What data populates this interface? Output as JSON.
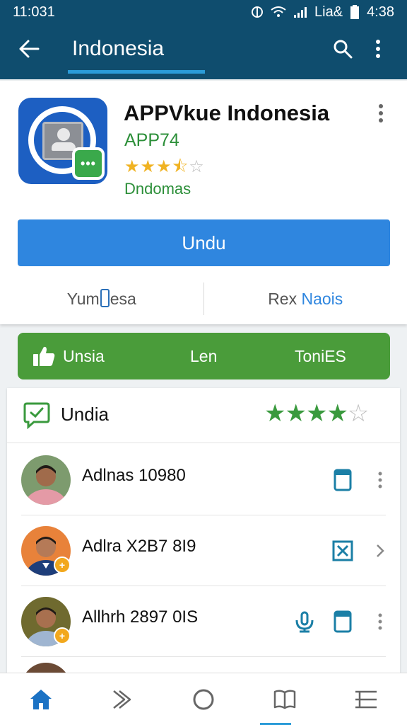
{
  "status_bar": {
    "time": "11:031",
    "carrier": "Lia&",
    "clock": "4:38"
  },
  "app_bar": {
    "title": "Indonesia",
    "back_icon": "arrow-left-icon",
    "search_icon": "search-icon",
    "menu_icon": "more-vertical-icon"
  },
  "app": {
    "name": "APPVkue Indonesia",
    "subtitle": "APP74",
    "rating_stars": "★★★★☆",
    "rating": 3.5,
    "developer": "Dndomas",
    "install_label": "Undu",
    "left_action_prefix": "Yum",
    "left_action_suffix": "esa",
    "right_action_prefix": "Rex ",
    "right_action_suffix": "Naois",
    "colors": {
      "install": "#2f86df",
      "accent_green": "#2c8f39",
      "star": "#f0b323"
    }
  },
  "green_bar": {
    "items": [
      "Unsia",
      "Len",
      "ToniES"
    ],
    "color": "#4a9c3a",
    "thumb_icon": "thumbs-up-icon"
  },
  "list": {
    "title": "Undia",
    "rating_stars": "★★★★☆",
    "rating": 4,
    "header_icon": "chat-check-icon",
    "items": [
      {
        "name": "Adlnas 10980",
        "action_icon": "document-icon",
        "trailing_icon": "more-vertical-icon"
      },
      {
        "name": "Adlra X2B7 8I9",
        "action_icon": "close-box-icon",
        "trailing_icon": "chevron-right-icon"
      },
      {
        "name": "Allhrh 2897 0IS",
        "action_icon": "microphone-icon",
        "action_icon_2": "document-icon",
        "trailing_icon": "more-vertical-icon"
      }
    ]
  },
  "bottom_nav": {
    "items": [
      "home-icon",
      "forward-icon",
      "circle-icon",
      "book-icon",
      "list-icon"
    ],
    "active_index": 0
  }
}
